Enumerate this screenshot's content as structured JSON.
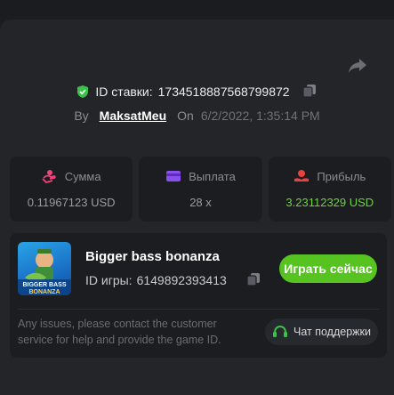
{
  "bet": {
    "id_label": "ID ставки:",
    "id_value": "1734518887568799872"
  },
  "author": {
    "by_label": "By",
    "username": "MaksatMeu",
    "on_label": "On",
    "timestamp": "6/2/2022, 1:35:14 PM"
  },
  "stats": [
    {
      "label": "Сумма",
      "value": "0.11967123 USD",
      "icon": "coins-icon"
    },
    {
      "label": "Выплата",
      "value": "28 x",
      "icon": "wallet-icon"
    },
    {
      "label": "Прибыль",
      "value": "3.23112329 USD",
      "icon": "profit-icon"
    }
  ],
  "game": {
    "title": "Bigger bass bonanza",
    "id_label": "ID игры:",
    "id_value": "6149892393413",
    "thumb_text_1": "BIGGER BASS",
    "thumb_text_2": "BONANZA",
    "play_label": "Играть сейчас",
    "issues_text": "Any issues, please contact the customer service for help and provide the game ID.",
    "support_label": "Чат поддержки"
  },
  "colors": {
    "accent_green": "#56c321",
    "profit_green": "#6ed23a",
    "pink_icon": "#f0457b",
    "purple_icon": "#8a4ff0",
    "red_icon": "#e8433f"
  }
}
